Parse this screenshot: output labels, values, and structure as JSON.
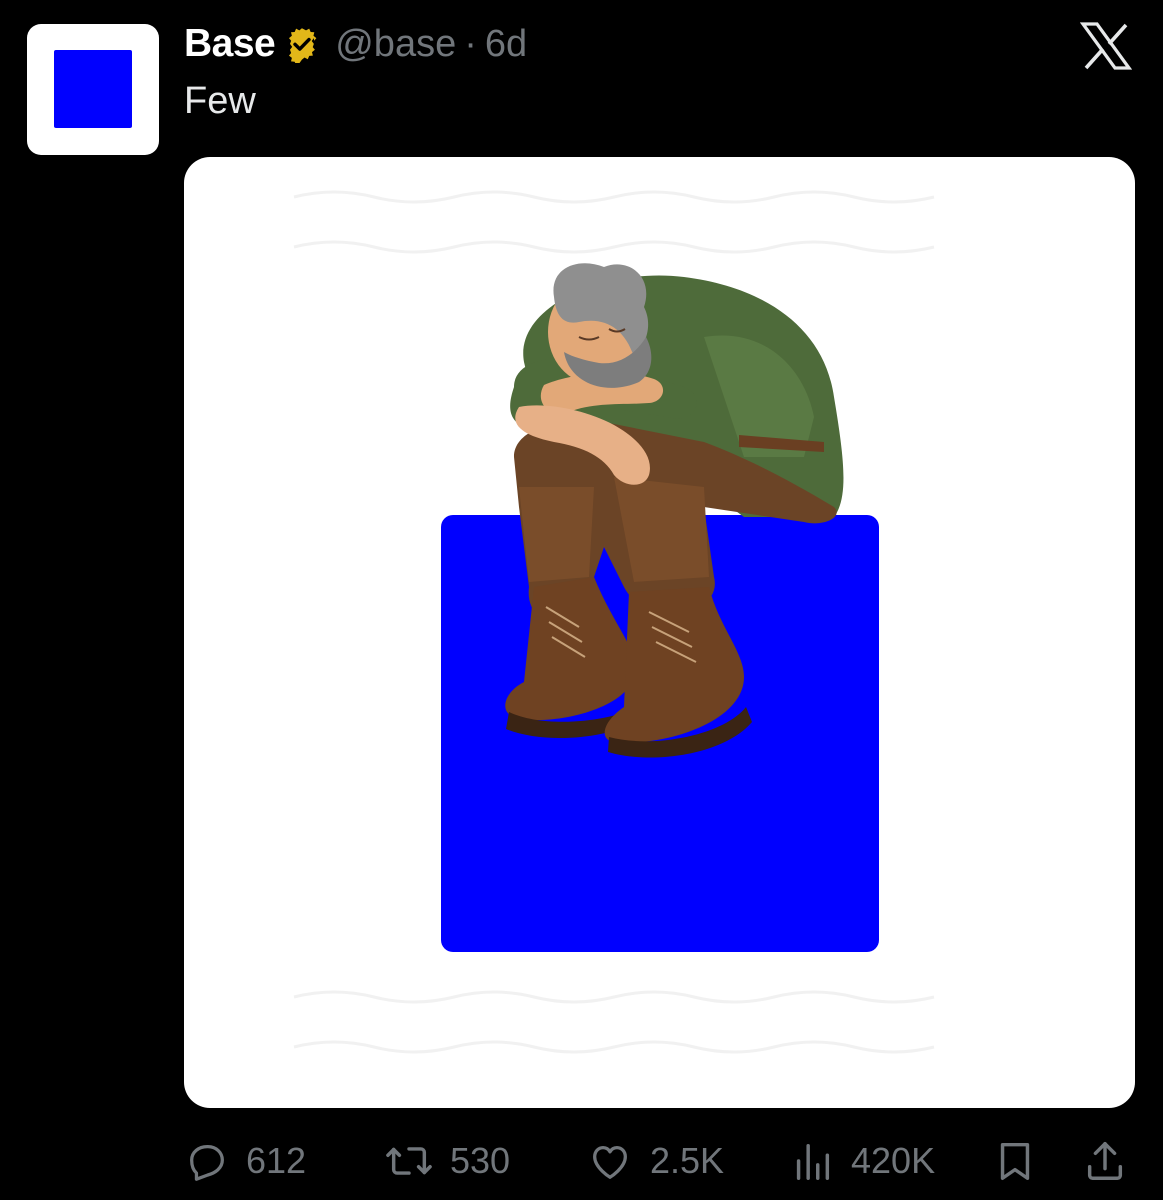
{
  "author": {
    "display_name": "Base",
    "handle": "@base",
    "separator": "·",
    "timestamp": "6d",
    "verified_icon": "gold-verified-badge-icon",
    "avatar_color": "#0000ff"
  },
  "tweet": {
    "text": "Few"
  },
  "media": {
    "description_icon": "sleeping-man-on-blue-square-image",
    "square_color": "#0000ff",
    "background_color": "#ffffff"
  },
  "platform_logo": "x-logo-icon",
  "actions": {
    "replies": {
      "icon": "reply-icon",
      "count": "612"
    },
    "reposts": {
      "icon": "repost-icon",
      "count": "530"
    },
    "likes": {
      "icon": "heart-icon",
      "count": "2.5K"
    },
    "views": {
      "icon": "views-icon",
      "count": "420K"
    },
    "bookmark": {
      "icon": "bookmark-icon"
    },
    "share": {
      "icon": "share-icon"
    }
  },
  "colors": {
    "background": "#000000",
    "muted_text": "#71767b",
    "primary_text": "#e7e9ea",
    "verified_gold": "#e2b719"
  }
}
